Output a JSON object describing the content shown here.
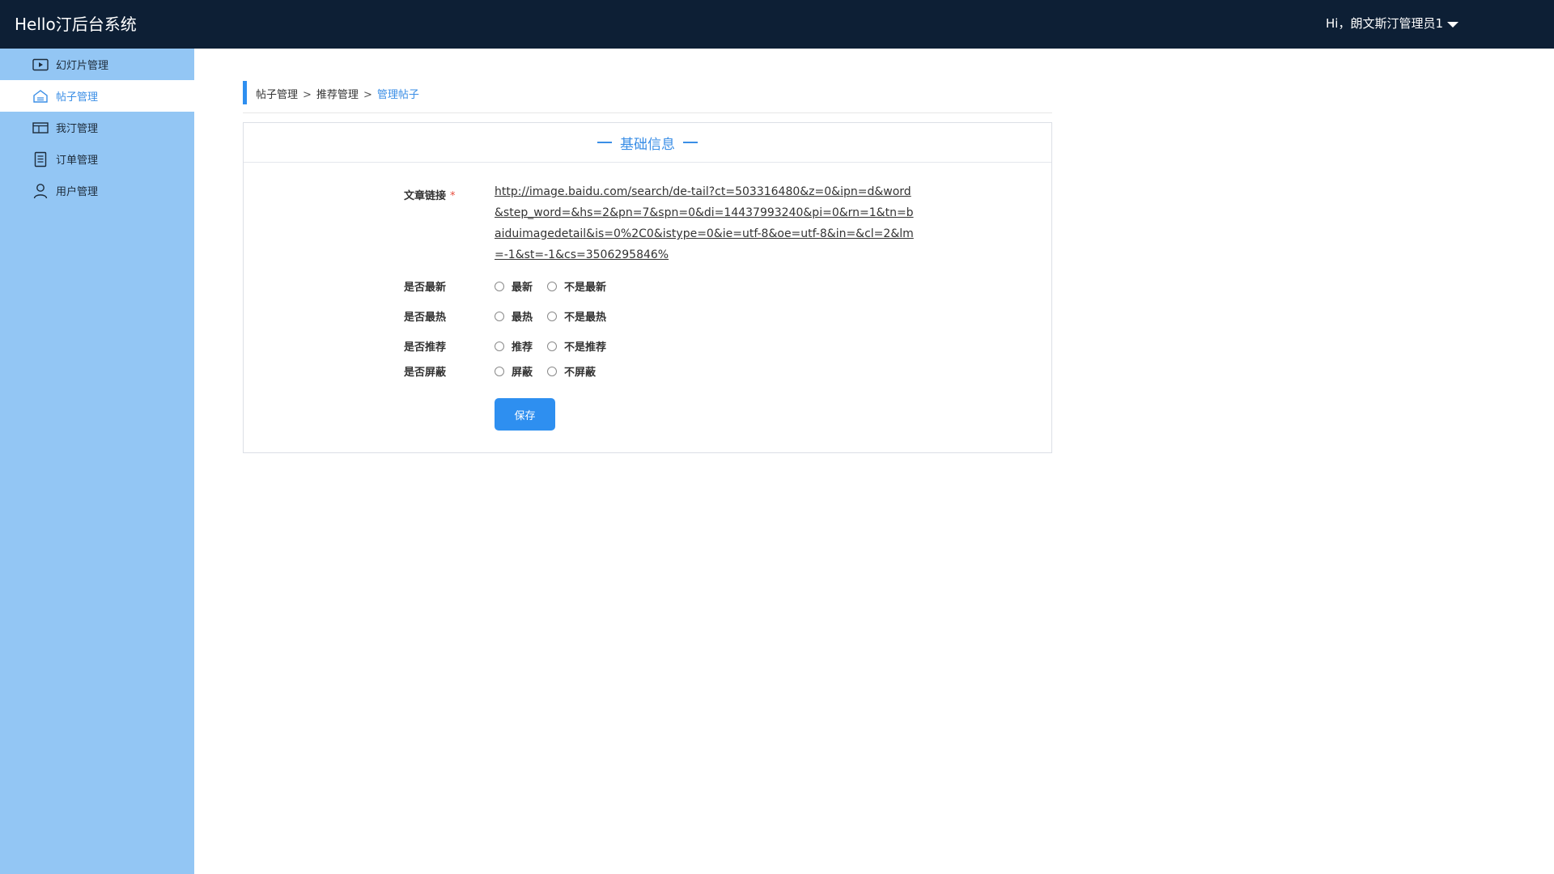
{
  "header": {
    "app_title": "Hello汀后台系统",
    "user_greeting": "Hi，朗文斯汀管理员1"
  },
  "sidebar": {
    "items": [
      {
        "label": "幻灯片管理",
        "icon": "slideshow-icon",
        "active": false
      },
      {
        "label": "帖子管理",
        "icon": "home-icon",
        "active": true
      },
      {
        "label": "我汀管理",
        "icon": "layout-icon",
        "active": false
      },
      {
        "label": "订单管理",
        "icon": "document-icon",
        "active": false
      },
      {
        "label": "用户管理",
        "icon": "user-icon",
        "active": false
      }
    ]
  },
  "breadcrumb": {
    "items": [
      "帖子管理",
      "推荐管理",
      "管理帖子"
    ],
    "separator": ">"
  },
  "panel": {
    "title": "基础信息"
  },
  "form": {
    "article_link_label": "文章链接",
    "required_mark": "*",
    "article_link_value": "http://image.baidu.com/search/de-tail?ct=503316480&z=0&ipn=d&word&step_word=&hs=2&pn=7&spn=0&di=14437993240&pi=0&rn=1&tn=baiduimagedetail&is=0%2C0&istype=0&ie=utf-8&oe=utf-8&in=&cl=2&lm=-1&st=-1&cs=3506295846%",
    "rows": [
      {
        "label": "是否最新",
        "option_yes": "最新",
        "option_no": "不是最新"
      },
      {
        "label": "是否最热",
        "option_yes": "最热",
        "option_no": "不是最热"
      },
      {
        "label": "是否推荐",
        "option_yes": "推荐",
        "option_no": "不是推荐"
      },
      {
        "label": "是否屏蔽",
        "option_yes": "屏蔽",
        "option_no": "不屏蔽"
      }
    ],
    "save_label": "保存"
  },
  "colors": {
    "topbar": "#0d1f35",
    "sidebar": "#93c6f4",
    "accent": "#2e8ff0",
    "required": "#e74c3c"
  }
}
